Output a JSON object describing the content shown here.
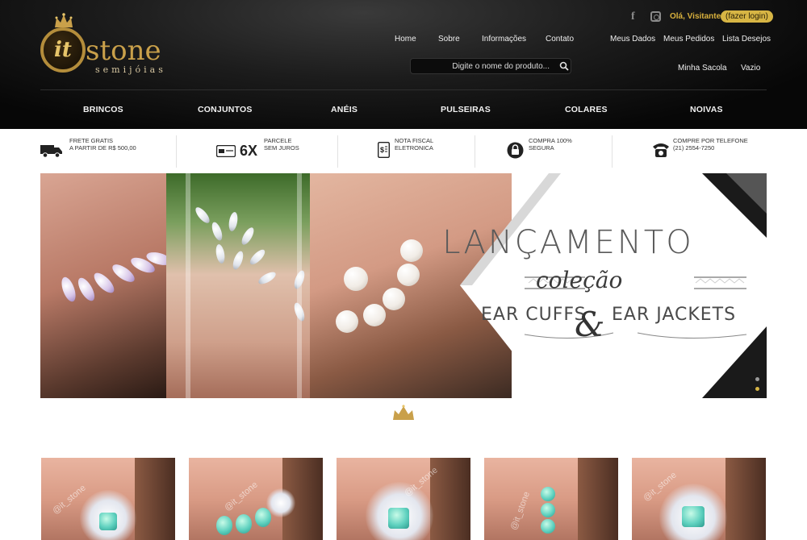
{
  "brand": {
    "logo_mark": "it",
    "name": "stone",
    "tagline": "semijóias"
  },
  "user": {
    "greeting": "Olá, Visitante",
    "login_label": "(fazer login)"
  },
  "top_nav": [
    {
      "label": "Home"
    },
    {
      "label": "Sobre"
    },
    {
      "label": "Informações"
    },
    {
      "label": "Contato"
    }
  ],
  "account_nav": [
    {
      "label": "Meus Dados"
    },
    {
      "label": "Meus Pedidos"
    },
    {
      "label": "Lista Desejos"
    }
  ],
  "cart": {
    "label": "Minha Sacola",
    "status": "Vazio"
  },
  "search": {
    "placeholder": "Digite o nome do produto..."
  },
  "categories": [
    {
      "label": "BRINCOS"
    },
    {
      "label": "CONJUNTOS"
    },
    {
      "label": "ANÉIS"
    },
    {
      "label": "PULSEIRAS"
    },
    {
      "label": "COLARES"
    },
    {
      "label": "NOIVAS"
    }
  ],
  "features": [
    {
      "icon": "truck-icon",
      "line1": "FRETE GRATIS",
      "line2": "A PARTIR DE R$ 500,00"
    },
    {
      "icon": "credit-card-icon",
      "big": "6X",
      "line1": "PARCELE",
      "line2": "SEM JUROS"
    },
    {
      "icon": "invoice-icon",
      "line1": "NOTA FISCAL",
      "line2": "ELETRONICA"
    },
    {
      "icon": "lock-icon",
      "line1": "COMPRA 100%",
      "line2": "SEGURA"
    },
    {
      "icon": "phone-icon",
      "line1": "COMPRE POR TELEFONE",
      "line2": "(21) 2554-7250"
    }
  ],
  "banner": {
    "title": "LANÇAMENTO",
    "subtitle": "coleção",
    "line_left": "EAR CUFFS",
    "ampersand": "&",
    "line_right": "EAR JACKETS",
    "slides": 2,
    "active_slide": 2
  },
  "products": [
    {
      "watermark": "@it_stone"
    },
    {
      "watermark": "@it_stone"
    },
    {
      "watermark": "@it_stone"
    },
    {
      "watermark": "@it_stone"
    },
    {
      "watermark": "@it_stone"
    }
  ],
  "colors": {
    "gold": "#d7b544",
    "header_bg": "#0a0a0a",
    "text_dark": "#333333"
  }
}
